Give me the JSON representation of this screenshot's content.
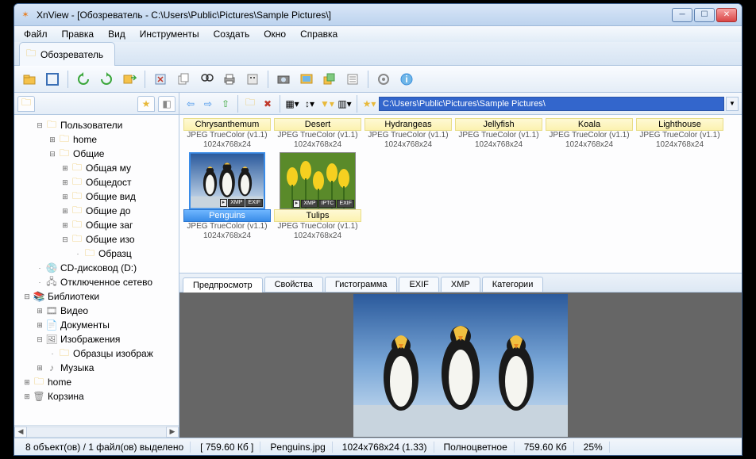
{
  "title": "XnView - [Обозреватель - C:\\Users\\Public\\Pictures\\Sample Pictures\\]",
  "menu": [
    "Файл",
    "Правка",
    "Вид",
    "Инструменты",
    "Создать",
    "Окно",
    "Справка"
  ],
  "main_tab": "Обозреватель",
  "path": "C:\\Users\\Public\\Pictures\\Sample Pictures\\",
  "tree": [
    {
      "indent": 1,
      "exp": "-",
      "icon": "folder",
      "label": "Пользователи"
    },
    {
      "indent": 2,
      "exp": "+",
      "icon": "folder",
      "label": "home"
    },
    {
      "indent": 2,
      "exp": "-",
      "icon": "folder",
      "label": "Общие"
    },
    {
      "indent": 3,
      "exp": "+",
      "icon": "folder",
      "label": "Общая му"
    },
    {
      "indent": 3,
      "exp": "+",
      "icon": "folder",
      "label": "Общедост"
    },
    {
      "indent": 3,
      "exp": "+",
      "icon": "folder",
      "label": "Общие вид"
    },
    {
      "indent": 3,
      "exp": "+",
      "icon": "folder",
      "label": "Общие до"
    },
    {
      "indent": 3,
      "exp": "+",
      "icon": "folder",
      "label": "Общие заг"
    },
    {
      "indent": 3,
      "exp": "-",
      "icon": "folder",
      "label": "Общие изо"
    },
    {
      "indent": 4,
      "exp": "",
      "icon": "folder",
      "label": "Образц"
    },
    {
      "indent": 1,
      "exp": "",
      "icon": "drive",
      "label": "CD-дисковод (D:)"
    },
    {
      "indent": 1,
      "exp": "",
      "icon": "net",
      "label": "Отключенное сетево"
    },
    {
      "indent": 0,
      "exp": "-",
      "icon": "lib",
      "label": "Библиотеки"
    },
    {
      "indent": 1,
      "exp": "+",
      "icon": "video",
      "label": "Видео"
    },
    {
      "indent": 1,
      "exp": "+",
      "icon": "doc",
      "label": "Документы"
    },
    {
      "indent": 1,
      "exp": "-",
      "icon": "pic",
      "label": "Изображения"
    },
    {
      "indent": 2,
      "exp": "",
      "icon": "folder",
      "label": "Образцы изображ"
    },
    {
      "indent": 1,
      "exp": "+",
      "icon": "music",
      "label": "Музыка"
    },
    {
      "indent": 0,
      "exp": "+",
      "icon": "folder",
      "label": "home"
    },
    {
      "indent": 0,
      "exp": "+",
      "icon": "bin",
      "label": "Корзина"
    }
  ],
  "files": [
    {
      "name": "Chrysanthemum",
      "meta1": "JPEG TrueColor (v1.1)",
      "meta2": "1024x768x24",
      "thumb": false
    },
    {
      "name": "Desert",
      "meta1": "JPEG TrueColor (v1.1)",
      "meta2": "1024x768x24",
      "thumb": false
    },
    {
      "name": "Hydrangeas",
      "meta1": "JPEG TrueColor (v1.1)",
      "meta2": "1024x768x24",
      "thumb": false
    },
    {
      "name": "Jellyfish",
      "meta1": "JPEG TrueColor (v1.1)",
      "meta2": "1024x768x24",
      "thumb": false
    },
    {
      "name": "Koala",
      "meta1": "JPEG TrueColor (v1.1)",
      "meta2": "1024x768x24",
      "thumb": false
    },
    {
      "name": "Lighthouse",
      "meta1": "JPEG TrueColor (v1.1)",
      "meta2": "1024x768x24",
      "thumb": false
    },
    {
      "name": "Penguins",
      "meta1": "JPEG TrueColor (v1.1)",
      "meta2": "1024x768x24",
      "thumb": true,
      "selected": true,
      "badges": [
        "XMP",
        "EXIF"
      ]
    },
    {
      "name": "Tulips",
      "meta1": "JPEG TrueColor (v1.1)",
      "meta2": "1024x768x24",
      "thumb": true,
      "badges": [
        "XMP",
        "IPTC",
        "EXIF"
      ]
    }
  ],
  "preview_tabs": [
    "Предпросмотр",
    "Свойства",
    "Гистограмма",
    "EXIF",
    "XMP",
    "Категории"
  ],
  "status": {
    "sel": "8 объект(ов) / 1 файл(ов) выделено",
    "size": "[ 759.60 Кб ]",
    "file": "Penguins.jpg",
    "dims": "1024x768x24 (1.33)",
    "color": "Полноцветное",
    "fsize": "759.60 Кб",
    "zoom": "25%"
  },
  "thumb_badge_play": "▸"
}
